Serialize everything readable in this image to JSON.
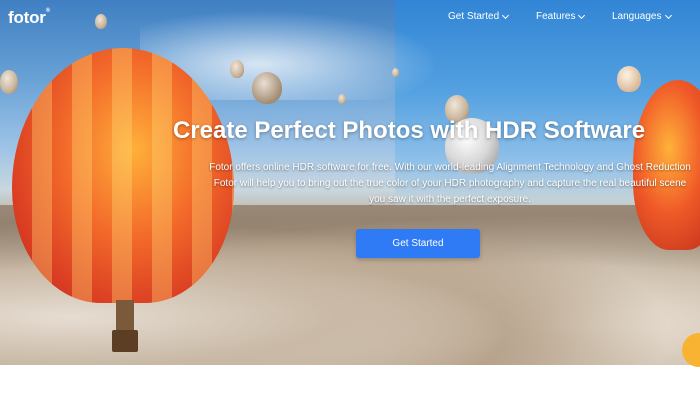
{
  "header": {
    "logo_text": "fotor",
    "logo_mark": "®",
    "nav": [
      {
        "label": "Get Started",
        "icon": "chevron-down-icon"
      },
      {
        "label": "Features",
        "icon": "chevron-down-icon"
      },
      {
        "label": "Languages",
        "icon": "chevron-down-icon"
      }
    ]
  },
  "hero": {
    "title": "Create Perfect Photos with HDR Software",
    "description_lines": [
      "Fotor offers online HDR software for free. With our world-leading Alignment Technology and Ghost Reduction",
      "Fotor will help you to bring out the true color of your HDR photography and capture the real beautiful scene",
      "you saw it with the perfect exposure."
    ],
    "cta_label": "Get Started"
  },
  "colors": {
    "cta_background": "#2f7bf5",
    "accent_circle": "#f9b333",
    "text": "#ffffff"
  }
}
